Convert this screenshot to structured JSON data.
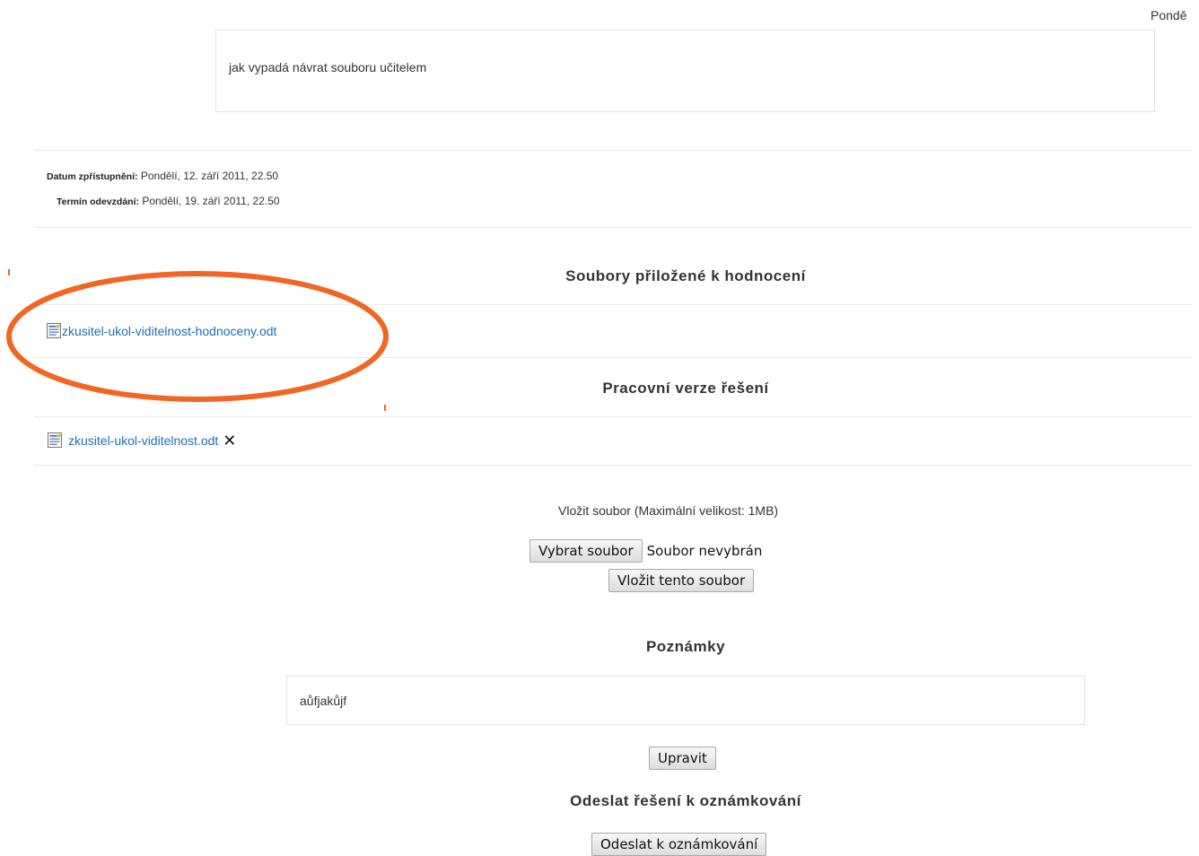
{
  "header": {
    "date_fragment": "Pondě"
  },
  "assignment": {
    "description": "jak vypadá návrat souboru učitelem"
  },
  "dates": {
    "available_label": "Datum zpřístupnění:",
    "available_value": "Pondělí, 12. září 2011, 22.50",
    "due_label": "Termín odevzdání:",
    "due_value": "Pondělí, 19. září 2011, 22.50"
  },
  "feedback_files": {
    "heading": "Soubory přiložené k hodnocení",
    "items": [
      {
        "name": "zkusitel-ukol-viditelnost-hodnoceny.odt",
        "icon": "document-icon"
      }
    ]
  },
  "draft": {
    "heading": "Pracovní verze řešení",
    "items": [
      {
        "name": "zkusitel-ukol-viditelnost.odt",
        "icon": "document-icon",
        "remove_icon": "close-icon"
      }
    ]
  },
  "upload": {
    "label": "Vložit soubor (Maximální velikost: 1MB)",
    "choose_button": "Vybrat soubor",
    "no_file_text": "Soubor nevybrán",
    "submit_button": "Vložit tento soubor"
  },
  "notes": {
    "heading": "Poznámky",
    "text": "aůfjakůjf",
    "edit_button": "Upravit"
  },
  "submit": {
    "heading": "Odeslat řešení k oznámkování",
    "button": "Odeslat k oznámkování"
  },
  "colors": {
    "link": "#1f6fb2",
    "annotation": "#f26522",
    "border": "#e3e3e3"
  }
}
